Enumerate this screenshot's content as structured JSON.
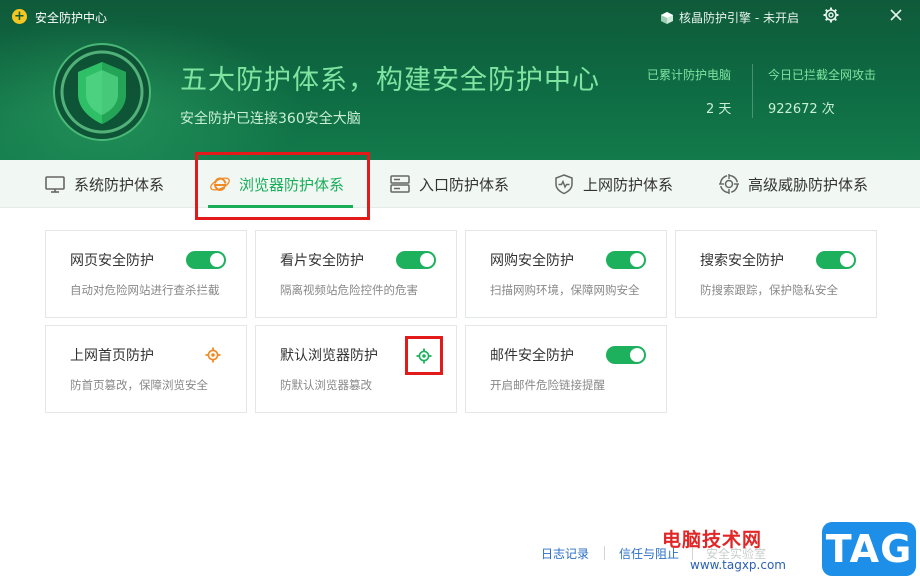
{
  "app": {
    "title": "安全防护中心",
    "engine_label": "核晶防护引擎 - 未开启"
  },
  "hero": {
    "headline": "五大防护体系，构建安全防护中心",
    "subline": "安全防护已连接360安全大脑",
    "stats": [
      {
        "label": "已累计防护电脑",
        "value": "2 天"
      },
      {
        "label": "今日已拦截全网攻击",
        "value": "922672 次"
      }
    ]
  },
  "tabs": [
    {
      "label": "系统防护体系",
      "icon": "monitor-icon"
    },
    {
      "label": "浏览器防护体系",
      "icon": "browser-e-icon",
      "active": true
    },
    {
      "label": "入口防护体系",
      "icon": "server-icon"
    },
    {
      "label": "上网防护体系",
      "icon": "shield-pulse-icon"
    },
    {
      "label": "高级威胁防护体系",
      "icon": "target-icon"
    }
  ],
  "cards": [
    {
      "title": "网页安全防护",
      "desc": "自动对危险网站进行查杀拦截",
      "control": "toggle",
      "enabled": true
    },
    {
      "title": "看片安全防护",
      "desc": "隔离视频站危险控件的危害",
      "control": "toggle",
      "enabled": true
    },
    {
      "title": "网购安全防护",
      "desc": "扫描网购环境，保障网购安全",
      "control": "toggle",
      "enabled": true
    },
    {
      "title": "搜索安全防护",
      "desc": "防搜索跟踪，保护隐私安全",
      "control": "toggle",
      "enabled": true
    },
    {
      "title": "上网首页防护",
      "desc": "防首页篡改，保障浏览安全",
      "control": "settings",
      "icon_color": "#f08a24"
    },
    {
      "title": "默认浏览器防护",
      "desc": "防默认浏览器篡改",
      "control": "settings",
      "icon_color": "#1db15d"
    },
    {
      "title": "邮件安全防护",
      "desc": "开启邮件危险链接提醒",
      "control": "toggle",
      "enabled": true
    }
  ],
  "footer": {
    "log": "日志记录",
    "trust": "信任与阻止",
    "faded": "安全实验室"
  },
  "watermark": {
    "text": "电脑技术网",
    "url": "www.tagxp.com",
    "tag": "TAG"
  },
  "colors": {
    "accent": "#1db15d",
    "header": "#0e6b43",
    "highlight": "#e21a1a",
    "link": "#2a6fc5"
  }
}
